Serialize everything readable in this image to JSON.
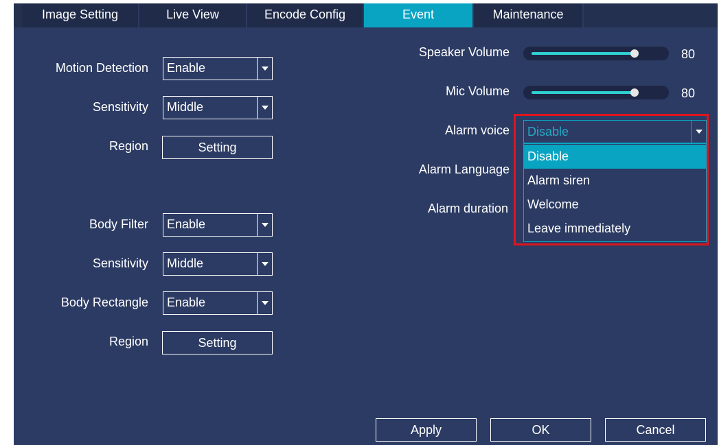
{
  "tabs": [
    {
      "label": "Image Setting"
    },
    {
      "label": "Live View"
    },
    {
      "label": "Encode Config"
    },
    {
      "label": "Event",
      "active": true
    },
    {
      "label": "Maintenance"
    }
  ],
  "left": {
    "motion_detection": {
      "label": "Motion Detection",
      "value": "Enable"
    },
    "sensitivity_1": {
      "label": "Sensitivity",
      "value": "Middle"
    },
    "region_1": {
      "label": "Region",
      "button": "Setting"
    },
    "body_filter": {
      "label": "Body Filter",
      "value": "Enable"
    },
    "sensitivity_2": {
      "label": "Sensitivity",
      "value": "Middle"
    },
    "body_rectangle": {
      "label": "Body Rectangle",
      "value": "Enable"
    },
    "region_2": {
      "label": "Region",
      "button": "Setting"
    }
  },
  "right": {
    "speaker_volume": {
      "label": "Speaker Volume",
      "value": "80",
      "level": 0.8
    },
    "mic_volume": {
      "label": "Mic Volume",
      "value": "80",
      "level": 0.8
    },
    "alarm_voice": {
      "label": "Alarm voice",
      "value": "Disable",
      "options": [
        "Disable",
        "Alarm siren",
        "Welcome",
        "Leave immediately"
      ],
      "selected_option": "Disable"
    },
    "alarm_language": {
      "label": "Alarm Language"
    },
    "alarm_duration": {
      "label": "Alarm duration"
    }
  },
  "footer": {
    "apply": "Apply",
    "ok": "OK",
    "cancel": "Cancel"
  },
  "colors": {
    "panel_bg": "#2c3b63",
    "tab_active": "#0aa4c3",
    "slider_fill": "#2fd0d2",
    "highlight_border": "#e0141e"
  },
  "icons": {
    "dropdown": "chevron-down-icon",
    "slider_knob": "slider-knob"
  }
}
